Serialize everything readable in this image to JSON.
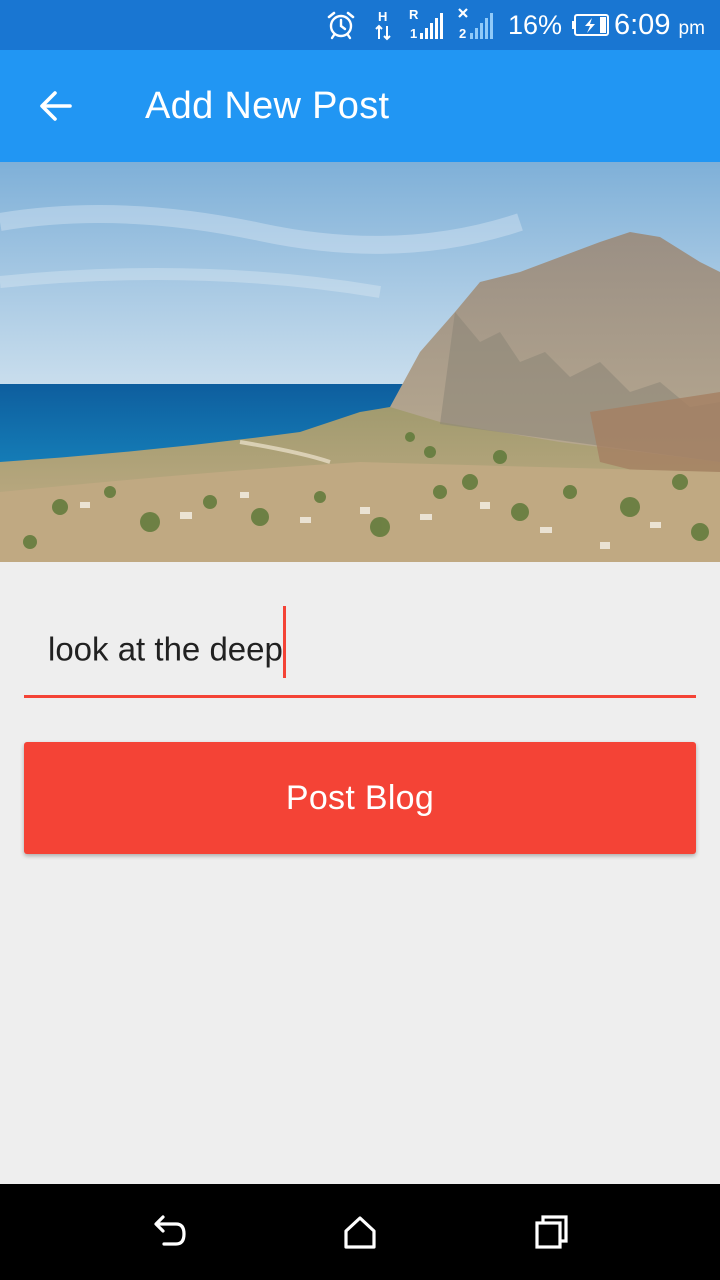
{
  "status_bar": {
    "battery_percent": "16%",
    "time": "6:09",
    "ampm": "pm",
    "network_labels": [
      "H",
      "R",
      "1",
      "2"
    ],
    "color": "#1976d2"
  },
  "app_bar": {
    "title": "Add New Post",
    "back_icon": "arrow-left-icon",
    "color": "#2196f3"
  },
  "header_image": {
    "subject": "coastal landscape with mountain and sea"
  },
  "post_input": {
    "value": "look at the deep",
    "accent_color": "#f44336"
  },
  "post_button": {
    "label": "Post Blog",
    "color": "#f44336"
  },
  "nav_bar": {
    "back_icon": "back-icon",
    "home_icon": "home-icon",
    "recents_icon": "recents-icon"
  }
}
